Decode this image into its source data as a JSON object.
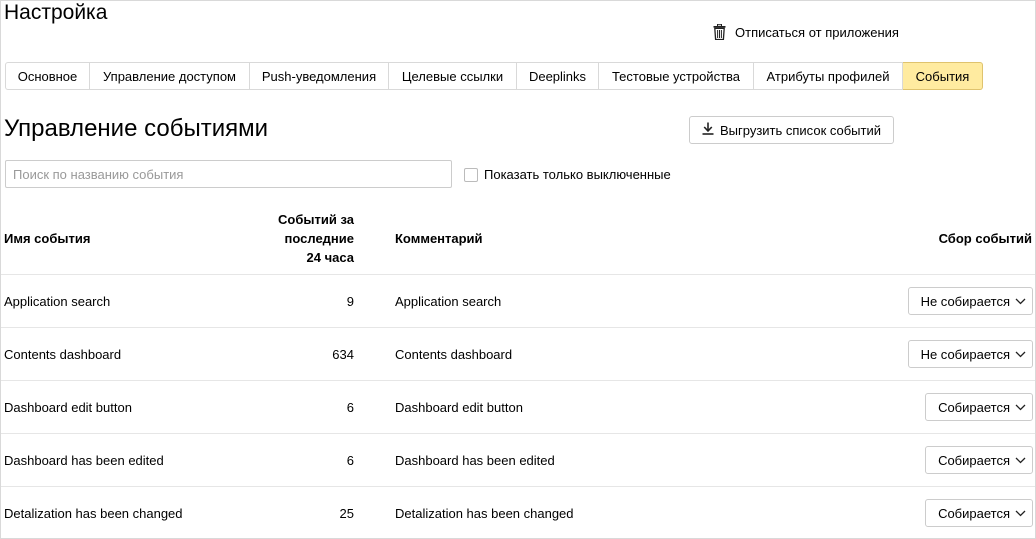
{
  "header": {
    "title": "Настройка",
    "unsubscribe_label": "Отписаться от приложения",
    "unsubscribe_icon": "trash-icon"
  },
  "tabs": [
    {
      "label": "Основное",
      "active": false
    },
    {
      "label": "Управление доступом",
      "active": false
    },
    {
      "label": "Push-уведомления",
      "active": false
    },
    {
      "label": "Целевые ссылки",
      "active": false
    },
    {
      "label": "Deeplinks",
      "active": false
    },
    {
      "label": "Тестовые устройства",
      "active": false
    },
    {
      "label": "Атрибуты профилей",
      "active": false
    },
    {
      "label": "События",
      "active": true
    }
  ],
  "section": {
    "title": "Управление событиями",
    "export_label": "Выгрузить список событий",
    "export_icon": "download-icon"
  },
  "search": {
    "placeholder": "Поиск по названию события",
    "value": ""
  },
  "filter": {
    "label": "Показать только выключенные",
    "checked": false
  },
  "table": {
    "headers": {
      "name": "Имя события",
      "count_line1": "Событий за",
      "count_line2": "последние",
      "count_line3": "24 часа",
      "comment": "Комментарий",
      "collect": "Сбор событий"
    },
    "rows": [
      {
        "name": "Application search",
        "count": "9",
        "comment": "Application search",
        "collect": "Не собирается"
      },
      {
        "name": "Contents dashboard",
        "count": "634",
        "comment": "Contents dashboard",
        "collect": "Не собирается"
      },
      {
        "name": "Dashboard edit button",
        "count": "6",
        "comment": "Dashboard edit button",
        "collect": "Собирается"
      },
      {
        "name": "Dashboard has been edited",
        "count": "6",
        "comment": "Dashboard has been edited",
        "collect": "Собирается"
      },
      {
        "name": "Detalization has been changed",
        "count": "25",
        "comment": "Detalization has been changed",
        "collect": "Собирается"
      }
    ]
  },
  "colors": {
    "active_tab": "#ffeba0",
    "border": "#d9d9d9"
  }
}
